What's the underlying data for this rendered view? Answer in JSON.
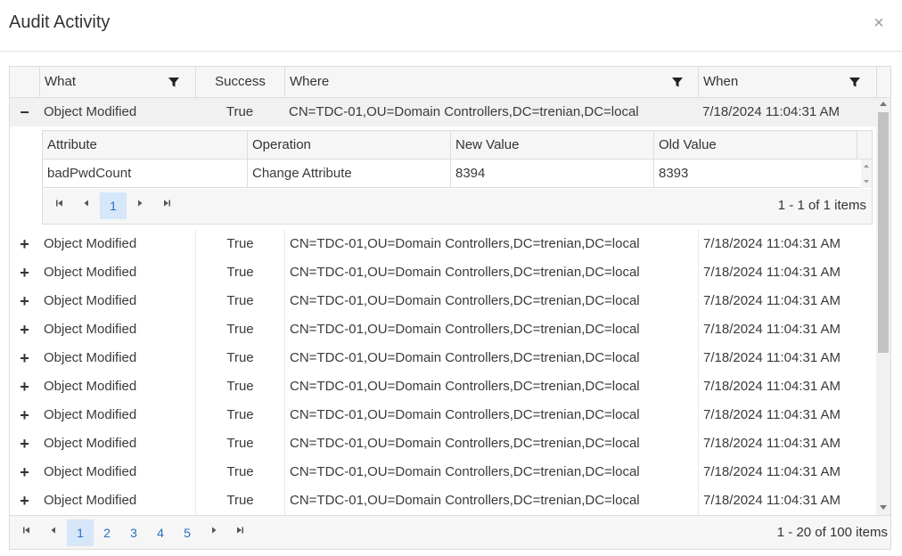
{
  "dialog": {
    "title": "Audit Activity",
    "close_glyph": "×"
  },
  "columns": {
    "what": "What",
    "success": "Success",
    "where": "Where",
    "when": "When"
  },
  "expanded_row": {
    "toggle": "−",
    "what": "Object Modified",
    "success": "True",
    "where": "CN=TDC-01,OU=Domain Controllers,DC=trenian,DC=local",
    "when": "7/18/2024 11:04:31 AM"
  },
  "detail": {
    "columns": {
      "attribute": "Attribute",
      "operation": "Operation",
      "new_value": "New Value",
      "old_value": "Old Value"
    },
    "rows": [
      {
        "attribute": "badPwdCount",
        "operation": "Change Attribute",
        "new_value": "8394",
        "old_value": "8393"
      }
    ],
    "pager": {
      "pages": [
        "1"
      ],
      "info": "1 - 1 of 1 items"
    }
  },
  "rows": [
    {
      "toggle": "+",
      "what": "Object Modified",
      "success": "True",
      "where": "CN=TDC-01,OU=Domain Controllers,DC=trenian,DC=local",
      "when": "7/18/2024 11:04:31 AM"
    },
    {
      "toggle": "+",
      "what": "Object Modified",
      "success": "True",
      "where": "CN=TDC-01,OU=Domain Controllers,DC=trenian,DC=local",
      "when": "7/18/2024 11:04:31 AM"
    },
    {
      "toggle": "+",
      "what": "Object Modified",
      "success": "True",
      "where": "CN=TDC-01,OU=Domain Controllers,DC=trenian,DC=local",
      "when": "7/18/2024 11:04:31 AM"
    },
    {
      "toggle": "+",
      "what": "Object Modified",
      "success": "True",
      "where": "CN=TDC-01,OU=Domain Controllers,DC=trenian,DC=local",
      "when": "7/18/2024 11:04:31 AM"
    },
    {
      "toggle": "+",
      "what": "Object Modified",
      "success": "True",
      "where": "CN=TDC-01,OU=Domain Controllers,DC=trenian,DC=local",
      "when": "7/18/2024 11:04:31 AM"
    },
    {
      "toggle": "+",
      "what": "Object Modified",
      "success": "True",
      "where": "CN=TDC-01,OU=Domain Controllers,DC=trenian,DC=local",
      "when": "7/18/2024 11:04:31 AM"
    },
    {
      "toggle": "+",
      "what": "Object Modified",
      "success": "True",
      "where": "CN=TDC-01,OU=Domain Controllers,DC=trenian,DC=local",
      "when": "7/18/2024 11:04:31 AM"
    },
    {
      "toggle": "+",
      "what": "Object Modified",
      "success": "True",
      "where": "CN=TDC-01,OU=Domain Controllers,DC=trenian,DC=local",
      "when": "7/18/2024 11:04:31 AM"
    },
    {
      "toggle": "+",
      "what": "Object Modified",
      "success": "True",
      "where": "CN=TDC-01,OU=Domain Controllers,DC=trenian,DC=local",
      "when": "7/18/2024 11:04:31 AM"
    },
    {
      "toggle": "+",
      "what": "Object Modified",
      "success": "True",
      "where": "CN=TDC-01,OU=Domain Controllers,DC=trenian,DC=local",
      "when": "7/18/2024 11:04:31 AM"
    }
  ],
  "pager": {
    "pages": [
      "1",
      "2",
      "3",
      "4",
      "5"
    ],
    "active_page": "1",
    "info": "1 - 20 of 100 items"
  },
  "icons": {
    "filter": "filter-icon",
    "first": "page-first-icon",
    "prev": "page-prev-icon",
    "next": "page-next-icon",
    "last": "page-last-icon"
  },
  "colors": {
    "accent": "#2a6ebd",
    "active_page_bg": "#d7e7fa",
    "header_bg": "#f6f6f6"
  }
}
